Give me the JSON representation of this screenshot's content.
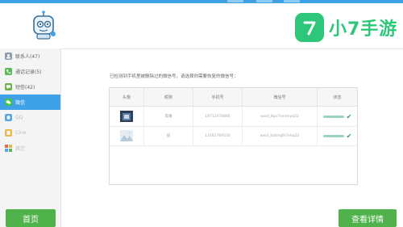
{
  "colors": {
    "accent": "#3fa2e6",
    "brand": "#2ec77a",
    "button": "#4fb24a"
  },
  "brand": {
    "name": "小7手游"
  },
  "sidebar": {
    "items": [
      {
        "label": "联系人(47)",
        "icon": "contacts-icon",
        "color": "#8c9bb0"
      },
      {
        "label": "通话记录(5)",
        "icon": "phone-icon",
        "color": "#5db85a"
      },
      {
        "label": "短信(42)",
        "icon": "sms-icon",
        "color": "#6db34a"
      },
      {
        "label": "微信",
        "icon": "wechat-icon",
        "color": "#3ec44b"
      },
      {
        "label": "QQ",
        "icon": "qq-icon",
        "color": "#5aa7e8"
      },
      {
        "label": "Cine",
        "icon": "notes-icon",
        "color": "#e8b84a"
      },
      {
        "label": "其它",
        "icon": "apps-icon",
        "color": "#e86a4a"
      }
    ]
  },
  "main": {
    "notice": "已检测到手机里被删除过的微信号，请选择你需要恢复的微信号：",
    "table": {
      "headers": [
        "头像",
        "昵称",
        "手机号",
        "微信号",
        "状态"
      ],
      "rows": [
        {
          "nickname": "晨曦",
          "phone": "18712078866",
          "wechat_id": "wxid_8gs7xmenyq22",
          "status": "checked"
        },
        {
          "nickname": "猫",
          "phone": "13182769518",
          "wechat_id": "wxid_tb4mg6l7ehq22",
          "status": "checked"
        }
      ]
    }
  },
  "footer": {
    "home_label": "首页",
    "details_label": "查看详情"
  }
}
